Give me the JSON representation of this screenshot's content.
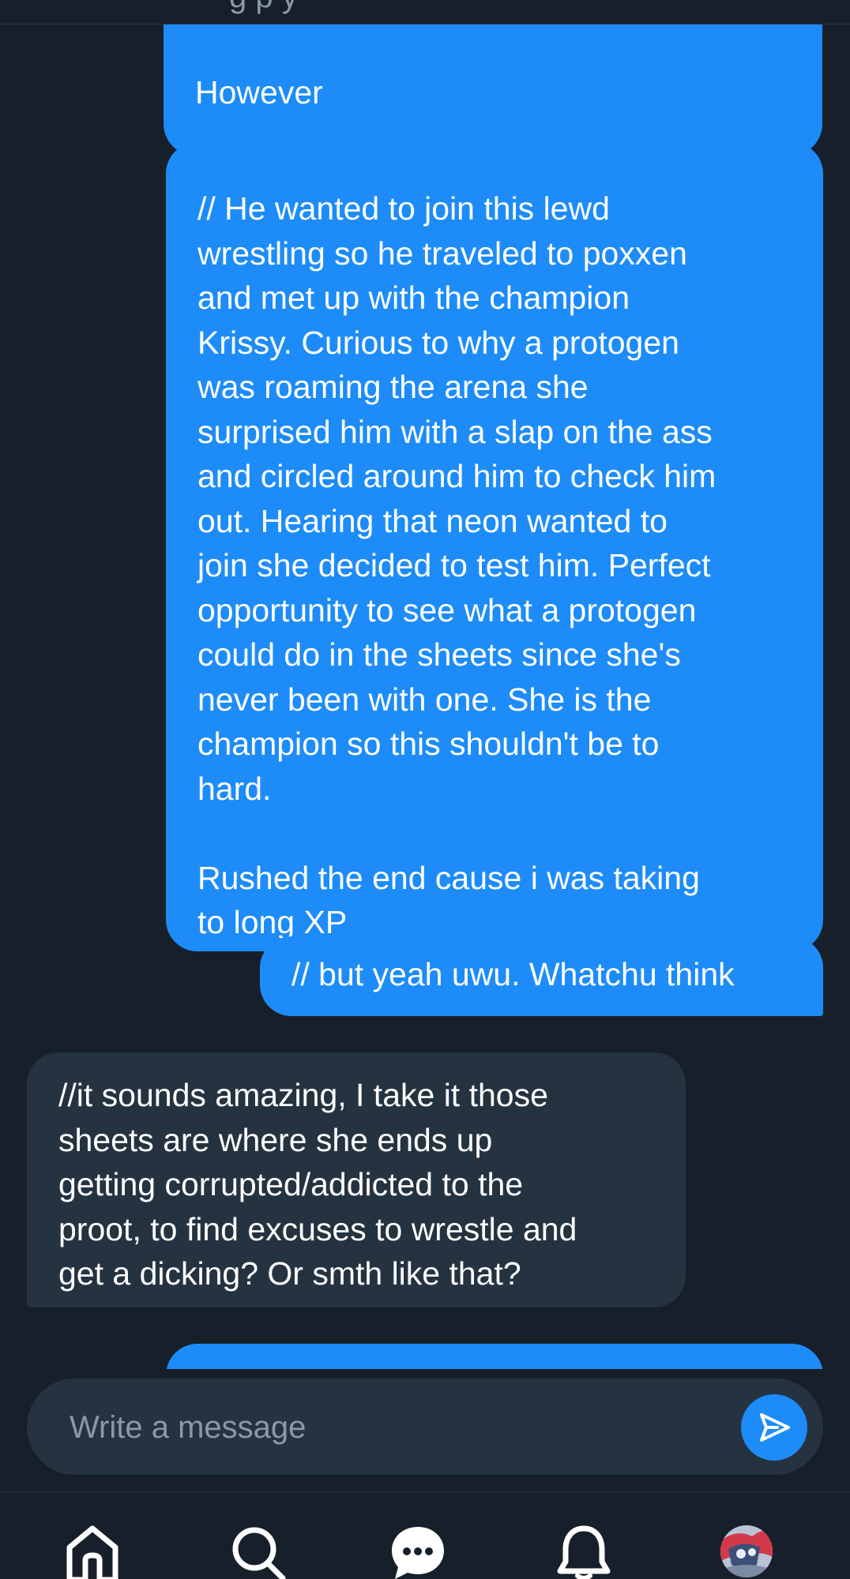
{
  "header": {
    "subtitle_fragment": "g         p              y"
  },
  "messages": [
    {
      "direction": "sent",
      "text": "However"
    },
    {
      "direction": "sent",
      "text": "// He wanted to join this lewd\nwrestling so he traveled to poxxen\nand met up with the champion\nKrissy. Curious to why a protogen\nwas roaming the arena she\nsurprised him with a slap on the ass\nand circled around him to check him\nout. Hearing that neon wanted to\njoin she decided to test him. Perfect\nopportunity to see what a protogen\ncould do in the sheets since she's\nnever been with one. She is the\nchampion so this shouldn't be to\nhard.\n\nRushed the end cause i was taking\nto long XP"
    },
    {
      "direction": "sent",
      "text": "// but yeah uwu. Whatchu think"
    },
    {
      "direction": "received",
      "text": "//it sounds amazing, I take it those\nsheets are where she ends up\ngetting corrupted/addicted to the\nproot, to find excuses to wrestle and\nget a dicking? Or smth like that?"
    },
    {
      "direction": "sent",
      "text": ""
    }
  ],
  "composer": {
    "placeholder": "Write a message",
    "value": "",
    "send_icon": "send-icon"
  },
  "bottom_nav": {
    "items": [
      {
        "name": "home",
        "icon": "home-icon"
      },
      {
        "name": "search",
        "icon": "search-icon"
      },
      {
        "name": "messages",
        "icon": "chat-bubble-icon"
      },
      {
        "name": "notifications",
        "icon": "bell-icon"
      },
      {
        "name": "profile",
        "icon": "avatar"
      }
    ]
  },
  "colors": {
    "background": "#17202a",
    "sent_bubble": "#1d8cf8",
    "received_bubble": "#253341",
    "placeholder": "#8b98a5"
  }
}
